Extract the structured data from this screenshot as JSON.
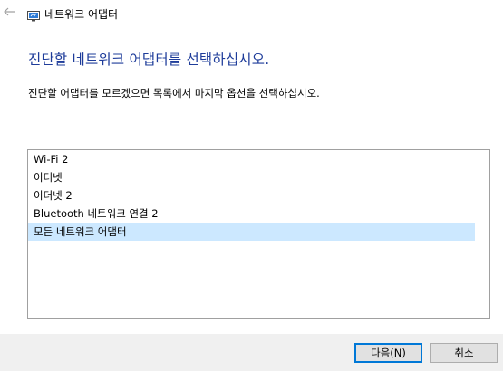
{
  "window": {
    "title": "네트워크 어댑터",
    "back_icon": "arrow-left-icon",
    "app_icon": "network-diagnostics-icon"
  },
  "main": {
    "heading": "진단할 네트워크 어댑터를 선택하십시오.",
    "instruction": "진단할 어댑터를 모르겠으면 목록에서 마지막 옵션을 선택하십시오."
  },
  "adapters": {
    "items": [
      {
        "label": "Wi-Fi 2"
      },
      {
        "label": "이더넷"
      },
      {
        "label": "이더넷 2"
      },
      {
        "label": "Bluetooth 네트워크 연결 2"
      },
      {
        "label": "모든 네트워크 어댑터"
      }
    ],
    "selected_index": 4
  },
  "buttons": {
    "next_label": "다음(N)",
    "cancel_label": "취소"
  },
  "colors": {
    "heading": "#1e3c9a",
    "selection": "#cce8ff",
    "footer": "#f0f0f0",
    "primary_border": "#0078d7"
  }
}
